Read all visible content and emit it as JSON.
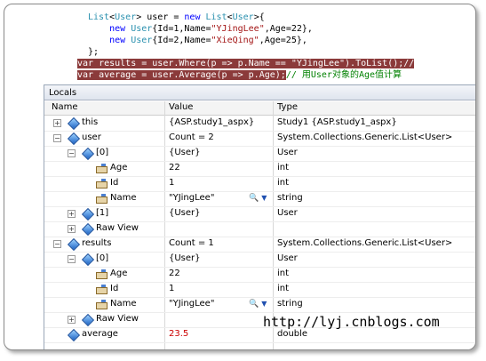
{
  "code": {
    "line1": [
      {
        "t": "List",
        "c": "ty"
      },
      {
        "t": "<",
        "c": ""
      },
      {
        "t": "User",
        "c": "ty"
      },
      {
        "t": "> user = ",
        "c": ""
      },
      {
        "t": "new",
        "c": "kw"
      },
      {
        "t": " ",
        "c": ""
      },
      {
        "t": "List",
        "c": "ty"
      },
      {
        "t": "<",
        "c": ""
      },
      {
        "t": "User",
        "c": "ty"
      },
      {
        "t": ">{",
        "c": ""
      }
    ],
    "line2": [
      {
        "t": "    new",
        "c": "kw"
      },
      {
        "t": " ",
        "c": ""
      },
      {
        "t": "User",
        "c": "ty"
      },
      {
        "t": "{Id=1,Name=",
        "c": ""
      },
      {
        "t": "\"YJingLee\"",
        "c": "str"
      },
      {
        "t": ",Age=22},",
        "c": ""
      }
    ],
    "line3": [
      {
        "t": "    new",
        "c": "kw"
      },
      {
        "t": " ",
        "c": ""
      },
      {
        "t": "User",
        "c": "ty"
      },
      {
        "t": "{Id=2,Name=",
        "c": ""
      },
      {
        "t": "\"XieQing\"",
        "c": "str"
      },
      {
        "t": ",Age=25},",
        "c": ""
      }
    ],
    "line4": [
      {
        "t": "};",
        "c": ""
      }
    ],
    "line5": [
      {
        "t": "var results = user.Where(p => p.Name == \"YJingLee\").ToList();//",
        "c": "hl"
      }
    ],
    "line6": [
      {
        "t": "var average = user.Average(p => p.Age);",
        "c": "hl"
      },
      {
        "t": "// 用User对象的Age值计算",
        "c": "cm"
      }
    ]
  },
  "locals": {
    "title": "Locals",
    "columns": {
      "name": "Name",
      "value": "Value",
      "type": "Type"
    },
    "rows": [
      {
        "expander": "+",
        "icon": "gem",
        "name": "this",
        "value": "{ASP.study1_aspx}",
        "type": "Study1 {ASP.study1_aspx}",
        "red": false,
        "tools": false
      },
      {
        "expander": "−",
        "icon": "gem",
        "name": "user",
        "value": "Count = 2",
        "type": "System.Collections.Generic.List<User>",
        "red": false,
        "tools": false
      },
      {
        "expander": "−",
        "icon": "gem",
        "name": "[0]",
        "value": "{User}",
        "type": "User",
        "red": false,
        "tools": false
      },
      {
        "expander": "",
        "icon": "prop",
        "name": "Age",
        "value": "22",
        "type": "int",
        "red": false,
        "tools": false
      },
      {
        "expander": "",
        "icon": "prop",
        "name": "Id",
        "value": "1",
        "type": "int",
        "red": false,
        "tools": false
      },
      {
        "expander": "",
        "icon": "prop",
        "name": "Name",
        "value": "\"YJingLee\"",
        "type": "string",
        "red": false,
        "tools": true
      },
      {
        "expander": "+",
        "icon": "gem",
        "name": "[1]",
        "value": "{User}",
        "type": "User",
        "red": false,
        "tools": false
      },
      {
        "expander": "+",
        "icon": "gem",
        "name": "Raw View",
        "value": "",
        "type": "",
        "red": false,
        "tools": false
      },
      {
        "expander": "−",
        "icon": "gem",
        "name": "results",
        "value": "Count = 1",
        "type": "System.Collections.Generic.List<User>",
        "red": false,
        "tools": false
      },
      {
        "expander": "−",
        "icon": "gem",
        "name": "[0]",
        "value": "{User}",
        "type": "User",
        "red": false,
        "tools": false
      },
      {
        "expander": "",
        "icon": "prop",
        "name": "Age",
        "value": "22",
        "type": "int",
        "red": false,
        "tools": false
      },
      {
        "expander": "",
        "icon": "prop",
        "name": "Id",
        "value": "1",
        "type": "int",
        "red": false,
        "tools": false
      },
      {
        "expander": "",
        "icon": "prop",
        "name": "Name",
        "value": "\"YJingLee\"",
        "type": "string",
        "red": false,
        "tools": true
      },
      {
        "expander": "+",
        "icon": "gem",
        "name": "Raw View",
        "value": "",
        "type": "",
        "red": false,
        "tools": false
      },
      {
        "expander": "",
        "icon": "gem",
        "name": "average",
        "value": "23.5",
        "type": "double",
        "red": true,
        "tools": false
      }
    ],
    "tools": {
      "magnifier": "🔍",
      "dropdown": "▼"
    }
  },
  "watermark": "http://lyj.cnblogs.com",
  "colors": {
    "red_value": "#cc0000",
    "highlight": "#8b3a3a",
    "keyword": "#0000ff",
    "type": "#2b91af",
    "string": "#a31515"
  }
}
